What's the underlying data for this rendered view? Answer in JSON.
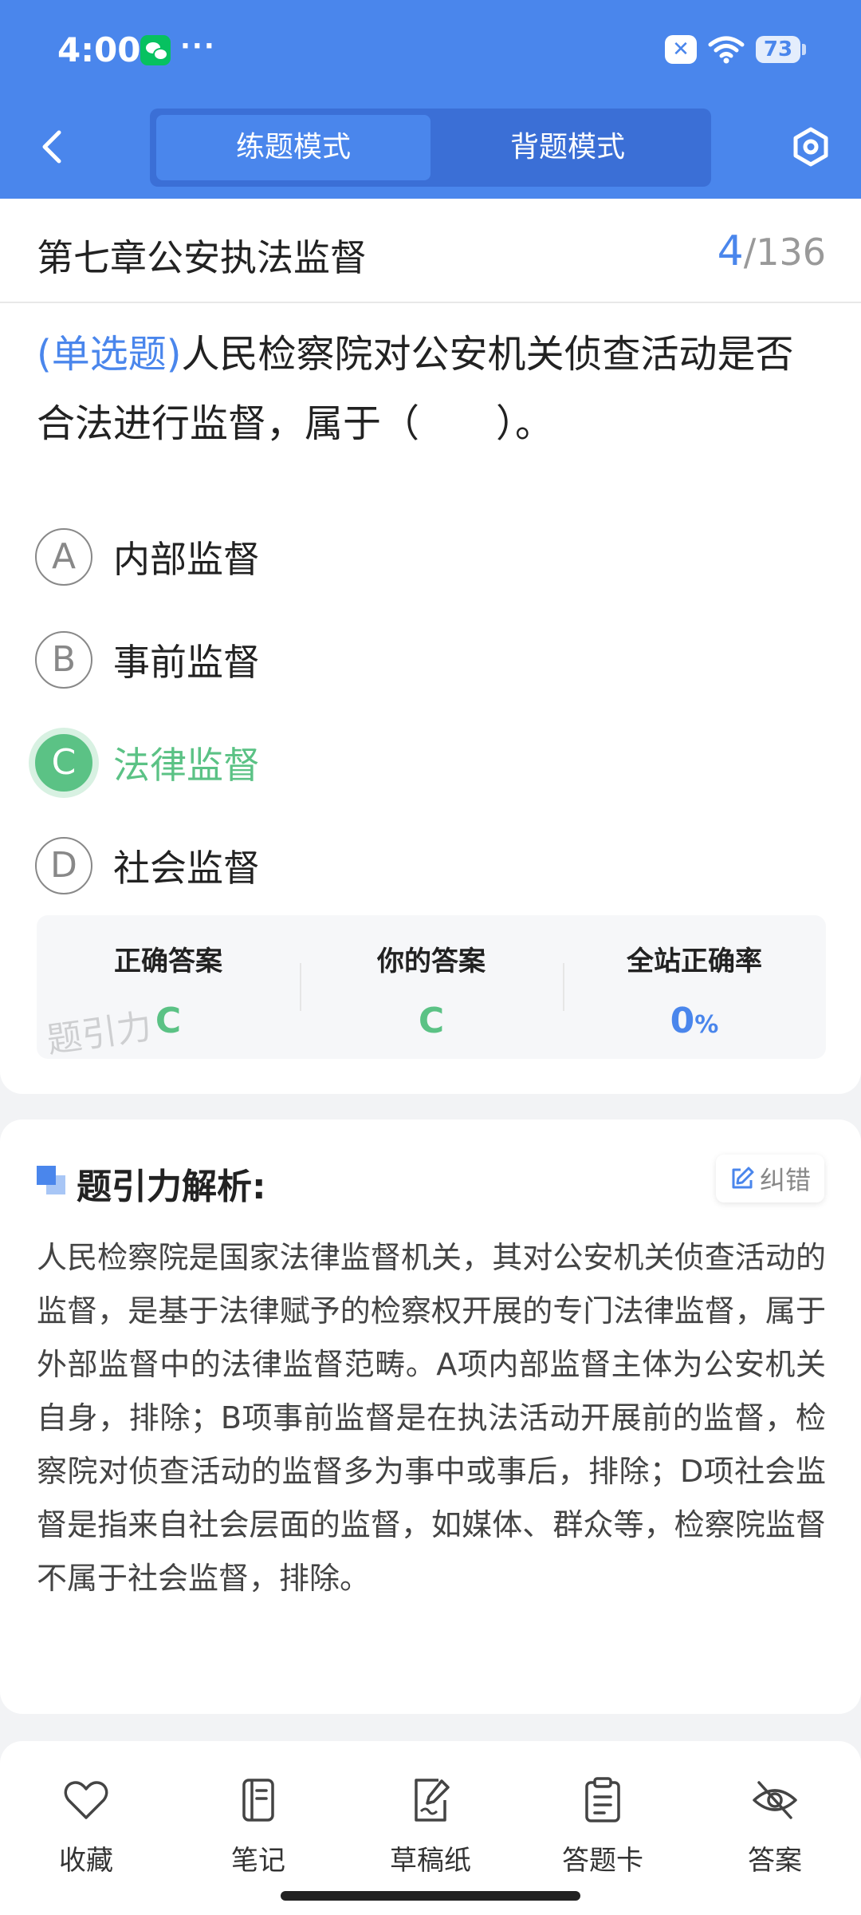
{
  "status_bar": {
    "time": "4:00",
    "dots": "···",
    "x_label": "✕",
    "battery": "73"
  },
  "header": {
    "mode_tabs": [
      {
        "label": "练题模式"
      },
      {
        "label": "背题模式"
      }
    ]
  },
  "chapter": {
    "title": "第七章公安执法监督",
    "current": "4",
    "separator": "/",
    "total": "136"
  },
  "question": {
    "type": "(单选题)",
    "text": "人民检察院对公安机关侦查活动是否合法进行监督，属于（　　）。",
    "options": [
      {
        "letter": "A",
        "text": "内部监督"
      },
      {
        "letter": "B",
        "text": "事前监督"
      },
      {
        "letter": "C",
        "text": "法律监督"
      },
      {
        "letter": "D",
        "text": "社会监督"
      }
    ]
  },
  "answer_stats": {
    "correct_label": "正确答案",
    "correct_value": "C",
    "yours_label": "你的答案",
    "yours_value": "C",
    "rate_label": "全站正确率",
    "rate_value": "0",
    "rate_unit": "%",
    "watermark": "题引力"
  },
  "analysis": {
    "title": "题引力解析:",
    "report_label": "纠错",
    "text": "人民检察院是国家法律监督机关，其对公安机关侦查活动的监督，是基于法律赋予的检察权开展的专门法律监督，属于外部监督中的法律监督范畴。A项内部监督主体为公安机关自身，排除；B项事前监督是在执法活动开展前的监督，检察院对侦查活动的监督多为事中或事后，排除；D项社会监督是指来自社会层面的监督，如媒体、群众等，检察院监督不属于社会监督，排除。"
  },
  "bottom_nav": [
    {
      "label": "收藏",
      "icon": "heart-icon"
    },
    {
      "label": "笔记",
      "icon": "notebook-icon"
    },
    {
      "label": "草稿纸",
      "icon": "draft-icon"
    },
    {
      "label": "答题卡",
      "icon": "answer-card-icon"
    },
    {
      "label": "答案",
      "icon": "eye-off-icon"
    }
  ],
  "colors": {
    "primary": "#4a86ec",
    "correct": "#5bc285",
    "text": "#222222"
  }
}
